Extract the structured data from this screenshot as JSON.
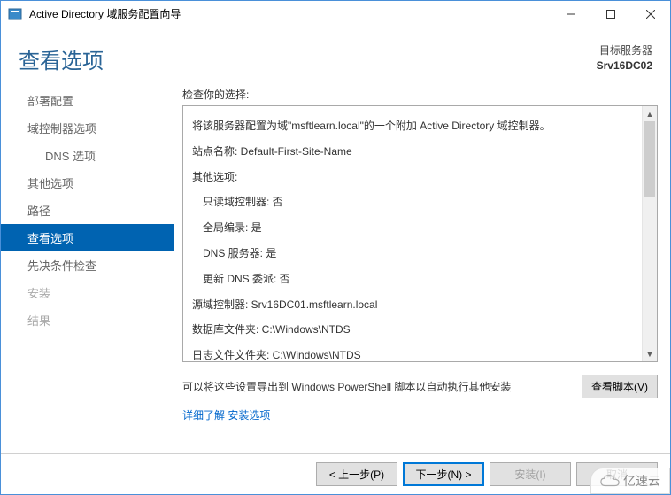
{
  "title": "Active Directory 域服务配置向导",
  "header": {
    "page_title": "查看选项",
    "target_label": "目标服务器",
    "target_value": "Srv16DC02"
  },
  "sidebar": {
    "items": [
      {
        "label": "部署配置"
      },
      {
        "label": "域控制器选项"
      },
      {
        "label": "DNS 选项"
      },
      {
        "label": "其他选项"
      },
      {
        "label": "路径"
      },
      {
        "label": "查看选项"
      },
      {
        "label": "先决条件检查"
      },
      {
        "label": "安装"
      },
      {
        "label": "结果"
      }
    ]
  },
  "content": {
    "review_label": "检查你的选择:",
    "lines": {
      "l0": "将该服务器配置为域\"msftlearn.local\"的一个附加 Active Directory 域控制器。",
      "l1": "站点名称: Default-First-Site-Name",
      "l2": "其他选项:",
      "l3": "只读域控制器: 否",
      "l4": "全局编录: 是",
      "l5": "DNS 服务器: 是",
      "l6": "更新 DNS 委派: 否",
      "l7": "源域控制器: Srv16DC01.msftlearn.local",
      "l8": "数据库文件夹: C:\\Windows\\NTDS",
      "l9": "日志文件文件夹: C:\\Windows\\NTDS"
    },
    "export_text": "可以将这些设置导出到 Windows PowerShell 脚本以自动执行其他安装",
    "view_script_btn": "查看脚本(V)",
    "more_link": "详细了解 安装选项"
  },
  "footer": {
    "prev": "< 上一步(P)",
    "next": "下一步(N) >",
    "install": "安装(I)",
    "cancel": "取消"
  },
  "watermark": "亿速云"
}
